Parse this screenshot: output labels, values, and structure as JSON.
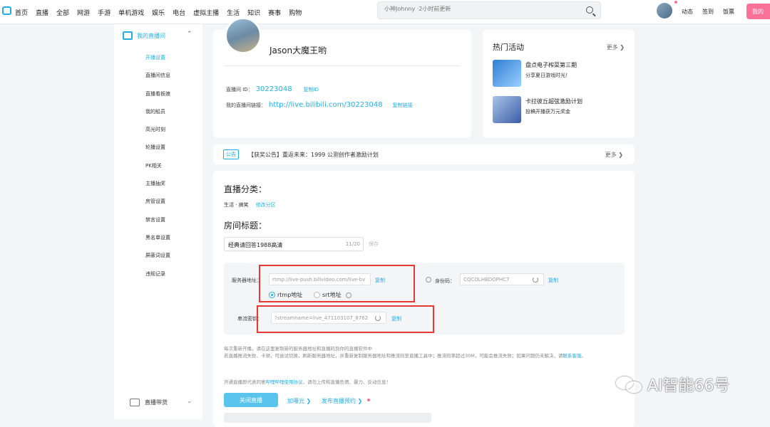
{
  "topnav": {
    "items": [
      "首页",
      "直播",
      "全部",
      "网游",
      "手游",
      "单机游戏",
      "娱乐",
      "电台",
      "虚拟主播",
      "生活",
      "知识",
      "赛事",
      "购物"
    ],
    "search_placeholder": "小神Johnny ·2小时前更新",
    "right_items": [
      "动态",
      "签到",
      "饭票"
    ],
    "live_button": "我的"
  },
  "sidebar": {
    "header": "我的直播间",
    "items": [
      "开播设置",
      "直播间信息",
      "直播看板娘",
      "我的船员",
      "高光时刻",
      "轮播设置",
      "PK相关",
      "主播抽奖",
      "房管设置",
      "禁言设置",
      "黑名单设置",
      "屏蔽词设置",
      "违规记录"
    ],
    "active_index": 0,
    "footer": "直播带货"
  },
  "profile": {
    "name": "Jason大魔王哟",
    "room_id_label": "直播间 ID：",
    "room_id": "30223048",
    "copy_id": "复制ID",
    "room_url_label": "我的直播间链接：",
    "room_url": "http://live.bilibili.com/30223048",
    "copy_url": "复制链接"
  },
  "hot": {
    "title": "热门活动",
    "more": "更多 ❯",
    "events": [
      {
        "title": "盘点电子榨菜第三期",
        "subtitle": "分享夏日游戏时光！"
      },
      {
        "title": "卡拉彼丘超弦激励计划",
        "subtitle": "投稿开播获万元奖金"
      }
    ]
  },
  "notice": {
    "tag": "公告",
    "text": "【获奖公告】重返未来：1999 公测创作者激励计划",
    "more": "更多 ❯"
  },
  "category": {
    "label": "直播分类：",
    "value": "生活 · 搞笑",
    "modify": "修改分区"
  },
  "room_title": {
    "label": "房间标题：",
    "value": "经典请回答1988高清",
    "count": "11/20",
    "save": "保存"
  },
  "stream": {
    "server_label": "服务器地址：",
    "server_value": "rtmp://live-push.bilivideo.com/live-bv",
    "copy": "复制",
    "auth_label": "身份码：",
    "auth_value": "CQCOLHBDOPHC7",
    "radio_rtmp": "rtmp地址",
    "radio_srt": "srt地址",
    "key_label": "串流密钥：",
    "key_value": "?streamname=live_471103107_8762"
  },
  "hints": {
    "line1": "每次重新开播，请在这里复制新的服务器地址和直播码到你的直播软件中",
    "line2": "若直播推流失败、卡顿，可尝试切换，刷新服务器地址，并重新复制服务器地址和推流码至直播工具中；推流码率超过30M，可能会推流失败；如果问题仍未解决，请",
    "line2_link": "联系客服",
    "line2_end": "。",
    "line3_pre": "开通直播即代表同意",
    "line3_link": "哔哩哔哩使用协议",
    "line3_post": "，请勿上传和直播色情、暴力、反动信息！"
  },
  "actions": {
    "stop": "关闭直播",
    "boost": "加曝光 ❯",
    "reserve": "发布直播预约 ❯"
  },
  "watermark": "AI智能66号",
  "colors": {
    "accent": "#23ade5",
    "pink": "#fb7299",
    "highlight": "#e53935"
  }
}
